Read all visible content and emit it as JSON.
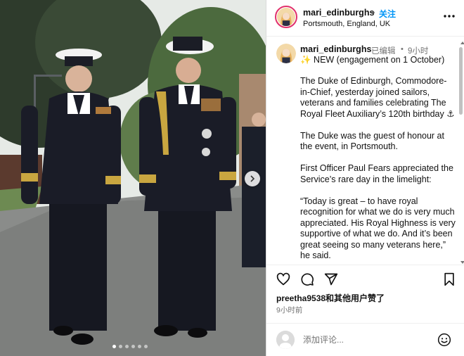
{
  "photo": {
    "description_icon": "post-photo",
    "carousel": {
      "current": 1,
      "total": 6
    }
  },
  "header": {
    "username": "mari_edinburghs",
    "separator": "•",
    "follow_label": "关注",
    "location": "Portsmouth, England, UK",
    "more_icon": "more-horizontal-icon"
  },
  "caption": {
    "username": "mari_edinburghs",
    "edited_label": "已编辑",
    "separator": "•",
    "time": "9小时",
    "new_line": "✨ NEW (engagement on 1 October)",
    "paragraphs": [
      "The Duke of Edinburgh, Commodore-in-Chief, yesterday joined sailors, veterans and families celebrating The Royal Fleet Auxiliary’s 120th birthday ⚓",
      "The Duke was the guest of honour at the event, in Portsmouth.",
      "First Officer Paul Fears appreciated the Service’s rare day in the limelight:",
      "“Today is great – to have royal recognition for what we do is very much appreciated. His Royal Highness is very supportive of what we do. And it’s been great seeing so many veterans here,” he said."
    ]
  },
  "actions": {
    "icons": [
      "heart-icon",
      "comment-icon",
      "share-icon",
      "bookmark-icon"
    ],
    "liked_by_user": "preetha9538",
    "liked_by_suffix": "和其他用户赞了",
    "date": "9小时前"
  },
  "comment": {
    "placeholder": "添加评论...",
    "emoji_icon": "emoji-icon"
  },
  "colors": {
    "accent": "#0095f6",
    "text": "#111111",
    "muted": "#737373",
    "story_ring": "#e1306c"
  }
}
